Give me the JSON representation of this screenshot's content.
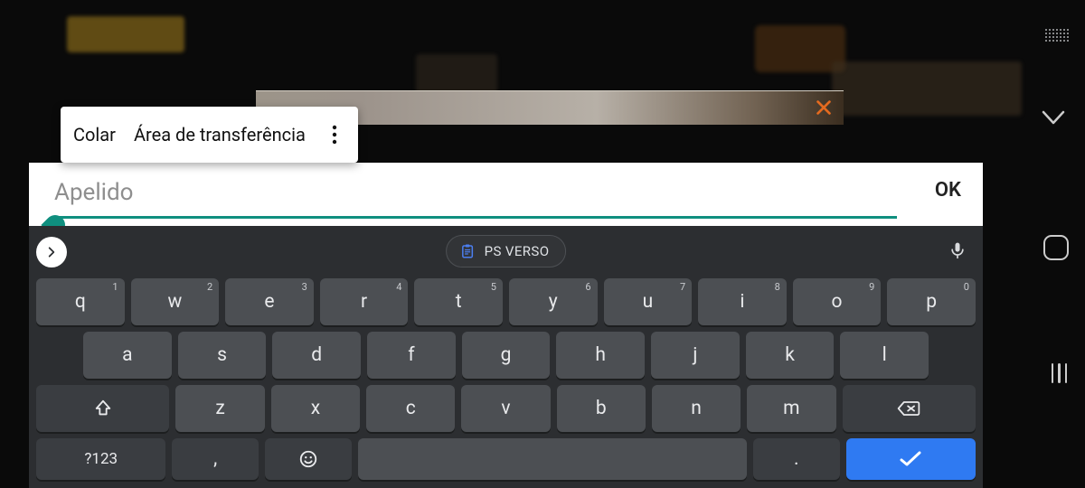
{
  "clipboard_menu": {
    "paste": "Colar",
    "clipboard": "Área de transferência"
  },
  "input": {
    "placeholder": "Apelido",
    "value": "",
    "ok": "OK"
  },
  "suggestion_chip": "PS VERSO",
  "keyboard": {
    "row1": [
      {
        "k": "q",
        "h": "1"
      },
      {
        "k": "w",
        "h": "2"
      },
      {
        "k": "e",
        "h": "3"
      },
      {
        "k": "r",
        "h": "4"
      },
      {
        "k": "t",
        "h": "5"
      },
      {
        "k": "y",
        "h": "6"
      },
      {
        "k": "u",
        "h": "7"
      },
      {
        "k": "i",
        "h": "8"
      },
      {
        "k": "o",
        "h": "9"
      },
      {
        "k": "p",
        "h": "0"
      }
    ],
    "row2": [
      "a",
      "s",
      "d",
      "f",
      "g",
      "h",
      "j",
      "k",
      "l"
    ],
    "row3": [
      "z",
      "x",
      "c",
      "v",
      "b",
      "n",
      "m"
    ],
    "symbols": "?123",
    "comma": ",",
    "period": "."
  }
}
